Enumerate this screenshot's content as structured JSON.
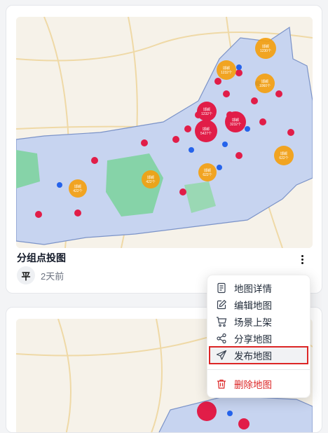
{
  "cards": [
    {
      "title": "分组点投图",
      "avatar": "平",
      "time": "2天前"
    },
    {
      "title": "",
      "avatar": "",
      "time": ""
    }
  ],
  "menu": {
    "items": [
      {
        "label": "地图详情",
        "icon": "document-icon"
      },
      {
        "label": "编辑地图",
        "icon": "edit-icon"
      },
      {
        "label": "场景上架",
        "icon": "cart-icon"
      },
      {
        "label": "分享地图",
        "icon": "share-icon"
      },
      {
        "label": "发布地图",
        "icon": "send-icon"
      },
      {
        "label": "删除地图",
        "icon": "trash-icon"
      }
    ]
  },
  "clusters": [
    {
      "name": "邯郸",
      "count": "1230个"
    },
    {
      "name": "邯郸",
      "count": "1232个"
    },
    {
      "name": "邯郸",
      "count": "1060个"
    },
    {
      "name": "邯郸",
      "count": "1232个"
    },
    {
      "name": "邯郸",
      "count": "3232个"
    },
    {
      "name": "邯郸",
      "count": "5427个"
    },
    {
      "name": "邯郸",
      "count": "622个"
    },
    {
      "name": "邯郸",
      "count": "622个"
    },
    {
      "name": "邯郸",
      "count": "422个"
    },
    {
      "name": "邯郸",
      "count": "422个"
    }
  ],
  "colors": {
    "accent_red": "#dc2626",
    "cluster_red": "#e11d48",
    "cluster_orange": "#f59e0b",
    "region": "#c7d4f0",
    "green": "#86d3a8"
  }
}
